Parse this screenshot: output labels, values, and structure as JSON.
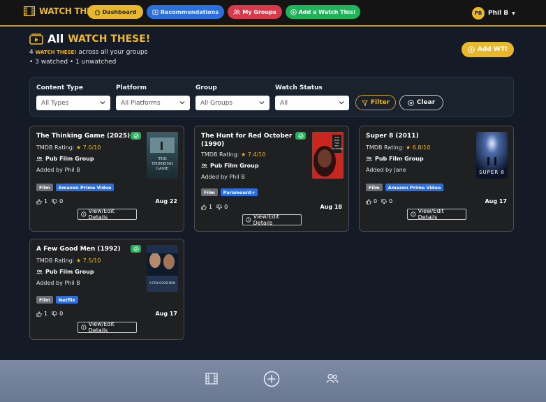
{
  "nav": {
    "brand": "WATCH THIS!",
    "dashboard": "Dashboard",
    "recommendations": "Recommendations",
    "my_groups": "My Groups",
    "add": "Add a Watch This!",
    "user_initials": "PB",
    "user_name": "Phil B"
  },
  "page": {
    "title": "All",
    "title_accent": "WATCH THESE!",
    "summary_count": "4",
    "summary_accent": "WATCH THESE!",
    "summary_rest": "across all your groups",
    "summary_status": "• 3 watched • 1 unwatched",
    "add_button": "Add WT!"
  },
  "filters": {
    "content_type_label": "Content Type",
    "content_type_value": "All Types",
    "platform_label": "Platform",
    "platform_value": "All Platforms",
    "group_label": "Group",
    "group_value": "All Groups",
    "status_label": "Watch Status",
    "status_value": "All",
    "filter_button": "Filter",
    "clear_button": "Clear"
  },
  "cards": [
    {
      "title": "The Thinking Game (2025)",
      "rating_label": "TMDB Rating:",
      "rating": "7.0/10",
      "group": "Pub Film Group",
      "added_by": "Added by Phil B",
      "tags": [
        "Film",
        "Amazon Prime Video"
      ],
      "likes": "1",
      "dislikes": "0",
      "date": "Aug 22",
      "button": "View/Edit Details",
      "poster_text": "THE THINKING GAME"
    },
    {
      "title": "The Hunt for Red October (1990)",
      "rating_label": "TMDB Rating:",
      "rating": "7.4/10",
      "group": "Pub Film Group",
      "added_by": "Added by Phil B",
      "tags": [
        "Film",
        "Paramount+"
      ],
      "likes": "1",
      "dislikes": "0",
      "date": "Aug 18",
      "button": "View/Edit Details",
      "poster_text": "THE HUNT FOR RED OCTOBER"
    },
    {
      "title": "Super 8 (2011)",
      "rating_label": "TMDB Rating:",
      "rating": "6.8/10",
      "group": "Pub Film Group",
      "added_by": "Added by Jane",
      "tags": [
        "Film",
        "Amazon Prime Video"
      ],
      "likes": "0",
      "dislikes": "0",
      "date": "Aug 17",
      "button": "View/Edit Details",
      "poster_text": "SUPER 8"
    },
    {
      "title": "A Few Good Men (1992)",
      "rating_label": "TMDB Rating:",
      "rating": "7.5/10",
      "group": "Pub Film Group",
      "added_by": "Added by Phil B",
      "tags": [
        "Film",
        "Netflix"
      ],
      "likes": "1",
      "dislikes": "0",
      "date": "Aug 17",
      "button": "View/Edit Details",
      "poster_text": "A FEW GOOD MEN"
    }
  ],
  "colors": {
    "accent": "#e9b72c",
    "blue": "#2a6fdc",
    "red": "#d93a4b",
    "green": "#20b35a",
    "background": "#141b26"
  }
}
